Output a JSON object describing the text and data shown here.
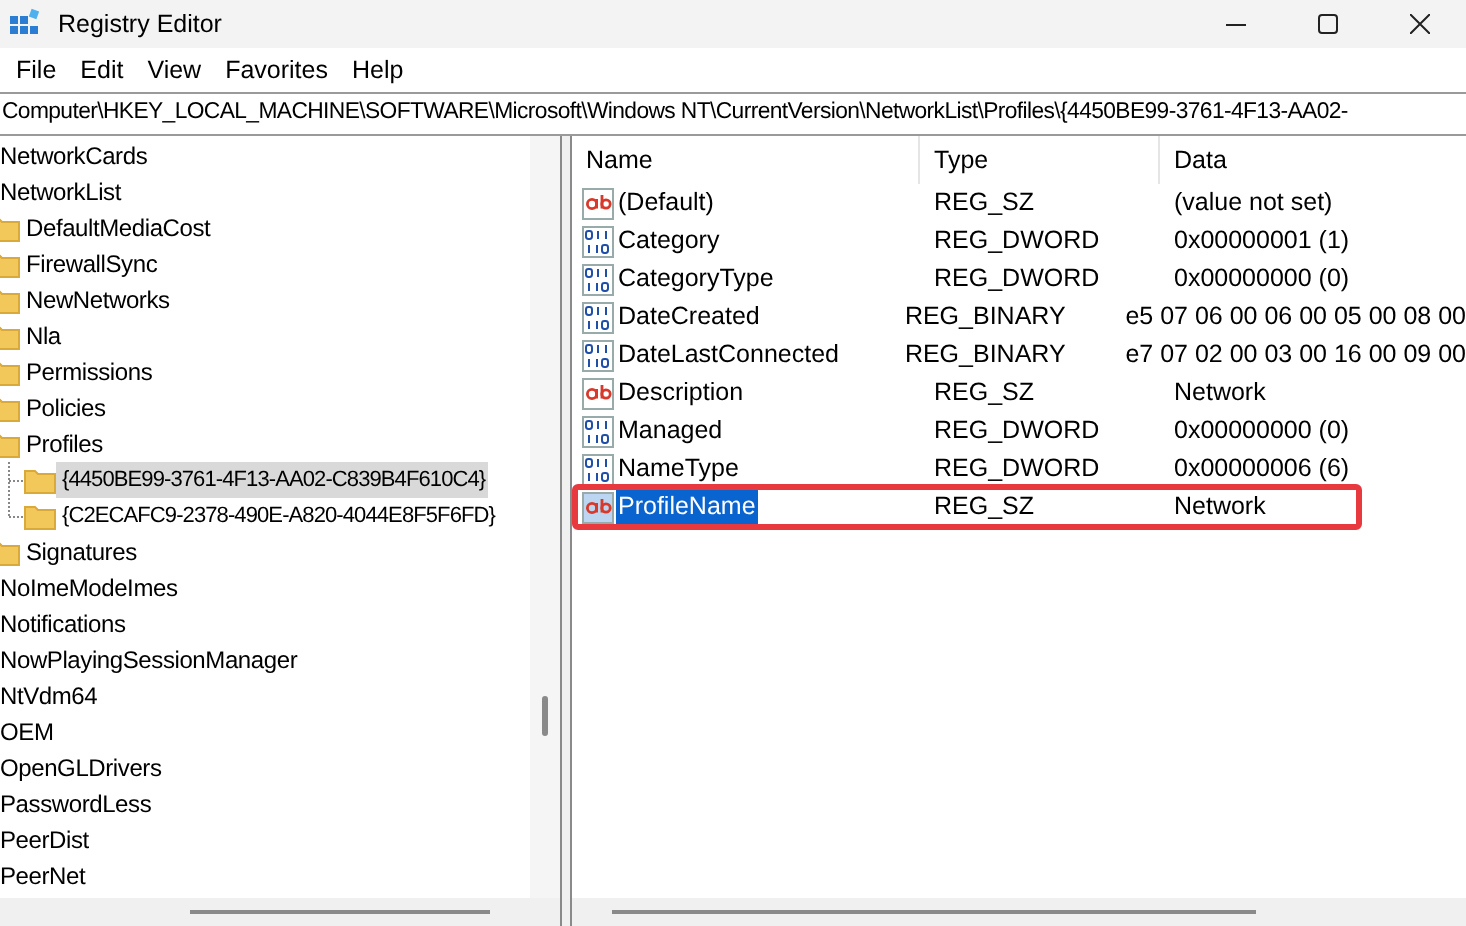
{
  "window": {
    "title": "Registry Editor"
  },
  "menu": [
    "File",
    "Edit",
    "View",
    "Favorites",
    "Help"
  ],
  "address": "Computer\\HKEY_LOCAL_MACHINE\\SOFTWARE\\Microsoft\\Windows NT\\CurrentVersion\\NetworkList\\Profiles\\{4450BE99-3761-4F13-AA02-",
  "tree": [
    {
      "label": "NetworkCards",
      "selected": false
    },
    {
      "label": "NetworkList",
      "selected": false,
      "children": [
        {
          "label": "DefaultMediaCost",
          "selected": false
        },
        {
          "label": "FirewallSync",
          "selected": false
        },
        {
          "label": "NewNetworks",
          "selected": false
        },
        {
          "label": "Nla",
          "selected": false
        },
        {
          "label": "Permissions",
          "selected": false
        },
        {
          "label": "Policies",
          "selected": false
        },
        {
          "label": "Profiles",
          "selected": false,
          "children": [
            {
              "label": "{4450BE99-3761-4F13-AA02-C839B4F610C4}",
              "selected": true
            },
            {
              "label": "{C2ECAFC9-2378-490E-A820-4044E8F5F6FD}",
              "selected": false
            }
          ]
        },
        {
          "label": "Signatures",
          "selected": false
        }
      ]
    },
    {
      "label": "NoImeModeImes",
      "selected": false
    },
    {
      "label": "Notifications",
      "selected": false
    },
    {
      "label": "NowPlayingSessionManager",
      "selected": false
    },
    {
      "label": "NtVdm64",
      "selected": false
    },
    {
      "label": "OEM",
      "selected": false
    },
    {
      "label": "OpenGLDrivers",
      "selected": false
    },
    {
      "label": "PasswordLess",
      "selected": false
    },
    {
      "label": "PeerDist",
      "selected": false
    },
    {
      "label": "PeerNet",
      "selected": false
    }
  ],
  "values": {
    "columns": [
      "Name",
      "Type",
      "Data"
    ],
    "rows": [
      {
        "kind": "string",
        "name": "(Default)",
        "type": "REG_SZ",
        "data": "(value not set)",
        "selected": false,
        "highlighted": false
      },
      {
        "kind": "binary",
        "name": "Category",
        "type": "REG_DWORD",
        "data": "0x00000001 (1)",
        "selected": false,
        "highlighted": false
      },
      {
        "kind": "binary",
        "name": "CategoryType",
        "type": "REG_DWORD",
        "data": "0x00000000 (0)",
        "selected": false,
        "highlighted": false
      },
      {
        "kind": "binary",
        "name": "DateCreated",
        "type": "REG_BINARY",
        "data": "e5 07 06 00 06 00 05 00 08 00",
        "selected": false,
        "highlighted": false
      },
      {
        "kind": "binary",
        "name": "DateLastConnected",
        "type": "REG_BINARY",
        "data": "e7 07 02 00 03 00 16 00 09 00",
        "selected": false,
        "highlighted": false
      },
      {
        "kind": "string",
        "name": "Description",
        "type": "REG_SZ",
        "data": "Network",
        "selected": false,
        "highlighted": false
      },
      {
        "kind": "binary",
        "name": "Managed",
        "type": "REG_DWORD",
        "data": "0x00000000 (0)",
        "selected": false,
        "highlighted": false
      },
      {
        "kind": "binary",
        "name": "NameType",
        "type": "REG_DWORD",
        "data": "0x00000006 (6)",
        "selected": false,
        "highlighted": false
      },
      {
        "kind": "string",
        "name": "ProfileName",
        "type": "REG_SZ",
        "data": "Network",
        "selected": true,
        "highlighted": true
      }
    ]
  }
}
